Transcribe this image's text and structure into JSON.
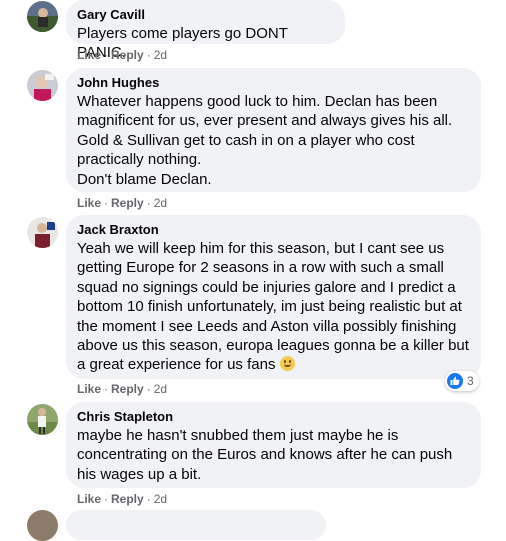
{
  "comments": [
    {
      "author": "Gary Cavill",
      "text": "Players come players go DONT PANIC..",
      "like_label": "Like",
      "reply_label": "Reply",
      "time": "2d"
    },
    {
      "author": "John Hughes",
      "text": "Whatever happens good luck to him. Declan has been magnificent for us, ever present and always gives his all. Gold & Sullivan get to cash in on a player who cost practically nothing.",
      "text2": "Don't blame Declan.",
      "like_label": "Like",
      "reply_label": "Reply",
      "time": "2d"
    },
    {
      "author": "Jack Braxton",
      "text": "Yeah we will keep him for this season, but I cant see us getting Europe for 2 seasons in a row with such a small squad no signings could be injuries galore and I predict a bottom 10 finish unfortunately, im just being realistic but at the moment I see Leeds and Aston villa possibly finishing above us this season, europa leagues gonna be a killer but a great experience for us fans",
      "reaction_count": "3",
      "like_label": "Like",
      "reply_label": "Reply",
      "time": "2d"
    },
    {
      "author": "Chris Stapleton",
      "text": "maybe he hasn't snubbed them just maybe he is concentrating on the Euros and knows after he can push his wages up a bit.",
      "like_label": "Like",
      "reply_label": "Reply",
      "time": "2d"
    }
  ],
  "colors": {
    "bubble": "#f0f2f5",
    "meta_text": "#65676b",
    "like_blue": "#1877f2"
  }
}
